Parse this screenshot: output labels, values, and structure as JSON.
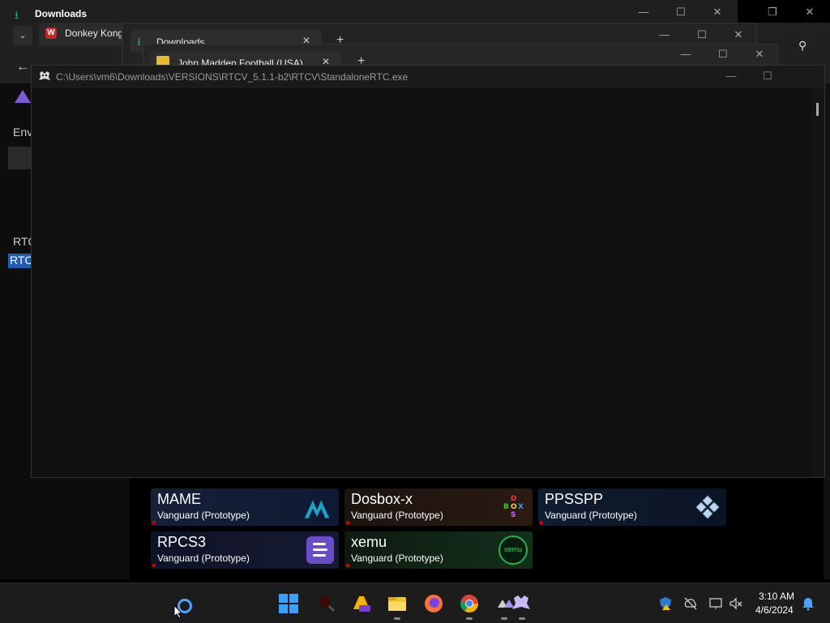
{
  "background_windows": {
    "downloads_title": "Downloads",
    "donkey_tab": "Donkey Kong",
    "downloads_tab": "Downloads",
    "madden_tab": "John Madden Football (USA)",
    "plus": "+",
    "env_label": "Env",
    "rtc_label_1": "RTC",
    "rtc_label_2": "RTC"
  },
  "main_window": {
    "title": "C:\\Users\\vm6\\Downloads\\VERSIONS\\RTCV_5.1.1-b2\\RTCV\\StandaloneRTC.exe"
  },
  "tiles": [
    {
      "name": "MAME",
      "sub": "Vanguard (Prototype)"
    },
    {
      "name": "Dosbox-x",
      "sub": "Vanguard (Prototype)"
    },
    {
      "name": "PPSSPP",
      "sub": "Vanguard (Prototype)"
    },
    {
      "name": "RPCS3",
      "sub": "Vanguard (Prototype)"
    },
    {
      "name": "xemu",
      "sub": "Vanguard (Prototype)"
    }
  ],
  "logo_text": {
    "dosbox": "D O B S X",
    "xemu": "xemu"
  },
  "taskbar": {
    "time": "3:10 AM",
    "date": "4/6/2024",
    "icons": [
      "cortana-icon",
      "windows-start-icon",
      "search-icon",
      "app-pre-icon",
      "file-explorer-icon",
      "firefox-icon",
      "chrome-icon",
      "rtcv-icon"
    ]
  }
}
